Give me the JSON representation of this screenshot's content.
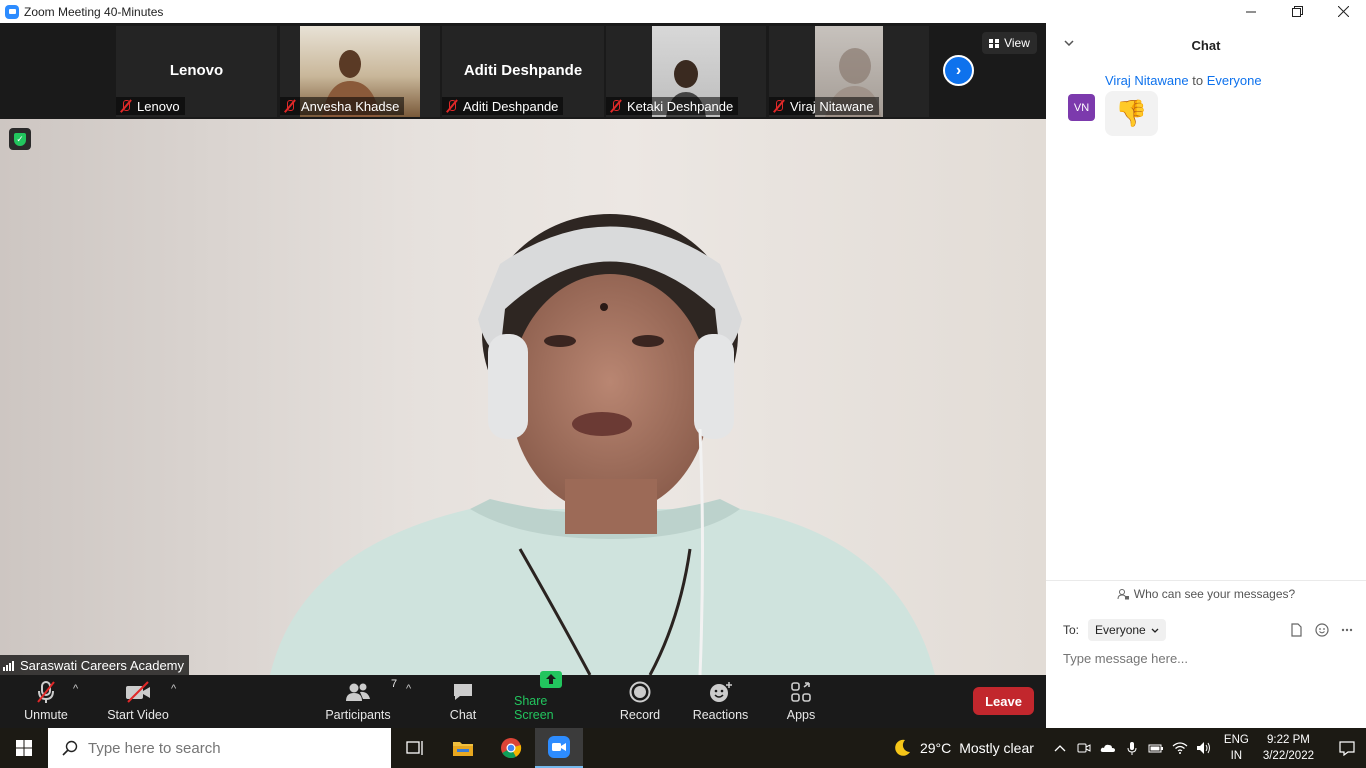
{
  "window": {
    "title": "Zoom Meeting 40-Minutes"
  },
  "strip": {
    "tiles": [
      {
        "big_name": "Lenovo",
        "label": "Lenovo",
        "video": false
      },
      {
        "big_name": "",
        "label": "Anvesha Khadse",
        "video": true
      },
      {
        "big_name": "Aditi Deshpande",
        "label": "Aditi Deshpande",
        "video": false
      },
      {
        "big_name": "",
        "label": "Ketaki Deshpande",
        "video": true
      },
      {
        "big_name": "",
        "label": "Viraj Nitawane",
        "video": true
      }
    ],
    "view_label": "View"
  },
  "main_video": {
    "name": "Saraswati Careers Academy"
  },
  "toolbar": {
    "unmute": "Unmute",
    "start_video": "Start Video",
    "participants": "Participants",
    "participants_count": "7",
    "chat": "Chat",
    "share_screen": "Share Screen",
    "record": "Record",
    "reactions": "Reactions",
    "apps": "Apps",
    "leave": "Leave"
  },
  "chat": {
    "title": "Chat",
    "messages": [
      {
        "sender": "Viraj Nitawane",
        "to_word": "to",
        "recipient": "Everyone",
        "avatar": "VN",
        "content": "👎"
      }
    ],
    "who_can_see": "Who can see your messages?",
    "to_label": "To:",
    "to_value": "Everyone",
    "input_placeholder": "Type message here..."
  },
  "taskbar": {
    "search_placeholder": "Type here to search",
    "weather_temp": "29°C",
    "weather_desc": "Mostly clear",
    "lang_1": "ENG",
    "lang_2": "IN",
    "time": "9:22 PM",
    "date": "3/22/2022"
  },
  "colors": {
    "zoom_blue": "#0e72ed",
    "share_green": "#22c55e",
    "leave_red": "#c2272d",
    "avatar_purple": "#7c3aad"
  }
}
